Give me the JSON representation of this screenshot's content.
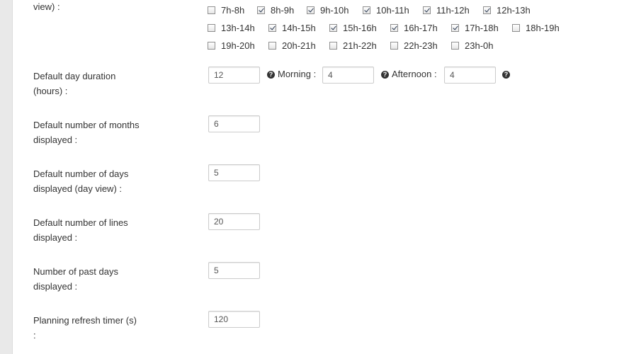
{
  "work_hours": {
    "label_tail": "view) :",
    "rows": [
      [
        {
          "label": "7h-8h",
          "checked": false
        },
        {
          "label": "8h-9h",
          "checked": true
        },
        {
          "label": "9h-10h",
          "checked": true
        },
        {
          "label": "10h-11h",
          "checked": true
        },
        {
          "label": "11h-12h",
          "checked": true
        },
        {
          "label": "12h-13h",
          "checked": true
        }
      ],
      [
        {
          "label": "13h-14h",
          "checked": false
        },
        {
          "label": "14h-15h",
          "checked": true
        },
        {
          "label": "15h-16h",
          "checked": true
        },
        {
          "label": "16h-17h",
          "checked": true
        },
        {
          "label": "17h-18h",
          "checked": true
        },
        {
          "label": "18h-19h",
          "checked": false
        }
      ],
      [
        {
          "label": "19h-20h",
          "checked": false
        },
        {
          "label": "20h-21h",
          "checked": false
        },
        {
          "label": "21h-22h",
          "checked": false
        },
        {
          "label": "22h-23h",
          "checked": false
        },
        {
          "label": "23h-0h",
          "checked": false
        }
      ]
    ]
  },
  "day_duration": {
    "label_line1": "Default day duration",
    "label_line2": "(hours) :",
    "value": "12",
    "morning_label": "Morning :",
    "morning_value": "4",
    "afternoon_label": "Afternoon :",
    "afternoon_value": "4",
    "help_glyph": "?"
  },
  "months_displayed": {
    "label_line1": "Default number of months",
    "label_line2": "displayed :",
    "value": "6"
  },
  "days_displayed": {
    "label_line1": "Default number of days",
    "label_line2": "displayed (day view) :",
    "value": "5"
  },
  "lines_displayed": {
    "label_line1": "Default number of lines",
    "label_line2": "displayed :",
    "value": "20"
  },
  "past_days": {
    "label_line1": "Number of past days",
    "label_line2": "displayed :",
    "value": "5"
  },
  "refresh_timer": {
    "label_line1": "Planning refresh timer (s)",
    "label_line2": ":",
    "value": "120"
  },
  "icons": {
    "help": "question-circle-icon"
  }
}
